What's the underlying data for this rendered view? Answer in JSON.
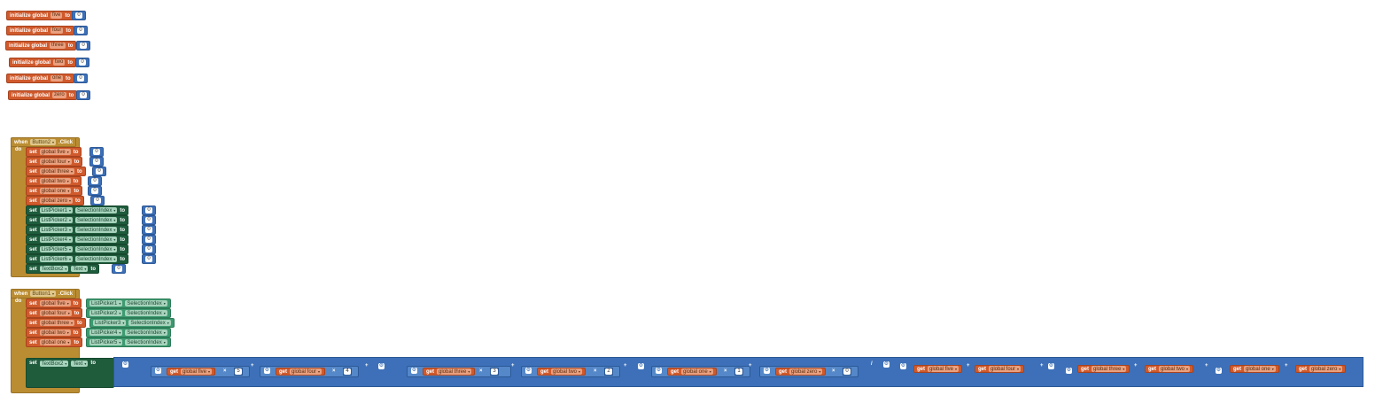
{
  "globals": [
    {
      "keyword": "initialize global",
      "name": "five",
      "to": "to",
      "value": "0"
    },
    {
      "keyword": "initialize global",
      "name": "four",
      "to": "to",
      "value": "0"
    },
    {
      "keyword": "initialize global",
      "name": "three",
      "to": "to",
      "value": "0"
    },
    {
      "keyword": "initialize global",
      "name": "two",
      "to": "to",
      "value": "0"
    },
    {
      "keyword": "initialize global",
      "name": "one",
      "to": "to",
      "value": "0"
    },
    {
      "keyword": "initialize global",
      "name": "zero",
      "to": "to",
      "value": "0"
    }
  ],
  "event2": {
    "when": "when",
    "component": "Button2",
    "event": ".Click",
    "do": "do",
    "set_globals": [
      {
        "set": "set",
        "name": "global five",
        "to": "to",
        "value": "0"
      },
      {
        "set": "set",
        "name": "global four",
        "to": "to",
        "value": "0"
      },
      {
        "set": "set",
        "name": "global three",
        "to": "to",
        "value": "0"
      },
      {
        "set": "set",
        "name": "global two",
        "to": "to",
        "value": "0"
      },
      {
        "set": "set",
        "name": "global one",
        "to": "to",
        "value": "0"
      },
      {
        "set": "set",
        "name": "global zero",
        "to": "to",
        "value": "0"
      }
    ],
    "set_pickers": [
      {
        "set": "set",
        "component": "ListPicker1",
        "property": "SelectionIndex",
        "to": "to",
        "value": "0"
      },
      {
        "set": "set",
        "component": "ListPicker2",
        "property": "SelectionIndex",
        "to": "to",
        "value": "0"
      },
      {
        "set": "set",
        "component": "ListPicker3",
        "property": "SelectionIndex",
        "to": "to",
        "value": "0"
      },
      {
        "set": "set",
        "component": "ListPicker4",
        "property": "SelectionIndex",
        "to": "to",
        "value": "0"
      },
      {
        "set": "set",
        "component": "ListPicker5",
        "property": "SelectionIndex",
        "to": "to",
        "value": "0"
      },
      {
        "set": "set",
        "component": "ListPicker6",
        "property": "SelectionIndex",
        "to": "to",
        "value": "0"
      }
    ],
    "set_text": {
      "set": "set",
      "component": "TextBox2",
      "property": "Text",
      "to": "to",
      "value": "0"
    }
  },
  "event1": {
    "when": "when",
    "component": "Button1",
    "event": ".Click",
    "do": "do",
    "set_globals": [
      {
        "set": "set",
        "name": "global five",
        "to": "to",
        "picker": "ListPicker1",
        "property": "SelectionIndex"
      },
      {
        "set": "set",
        "name": "global four",
        "to": "to",
        "picker": "ListPicker2",
        "property": "SelectionIndex"
      },
      {
        "set": "set",
        "name": "global three",
        "to": "to",
        "picker": "ListPicker3",
        "property": "SelectionIndex"
      },
      {
        "set": "set",
        "name": "global two",
        "to": "to",
        "picker": "ListPicker4",
        "property": "SelectionIndex"
      },
      {
        "set": "set",
        "name": "global one",
        "to": "to",
        "picker": "ListPicker5",
        "property": "SelectionIndex"
      }
    ],
    "set_text": {
      "set": "set",
      "component": "TextBox2",
      "property": "Text",
      "to": "to"
    },
    "expr": {
      "plus": "+",
      "times": "×",
      "divide": "/",
      "get": "get",
      "gear": "⚙",
      "numerator_terms": [
        {
          "var": "global five",
          "mult": "5"
        },
        {
          "var": "global four",
          "mult": "4"
        },
        {
          "var": "global three",
          "mult": "3"
        },
        {
          "var": "global two",
          "mult": "2"
        },
        {
          "var": "global one",
          "mult": "1"
        },
        {
          "var": "global zero",
          "mult": "0"
        }
      ],
      "denominator_vars": [
        "global five",
        "global four",
        "global three",
        "global two",
        "global one",
        "global zero"
      ]
    }
  },
  "icons": {
    "dropdown": "▾"
  }
}
